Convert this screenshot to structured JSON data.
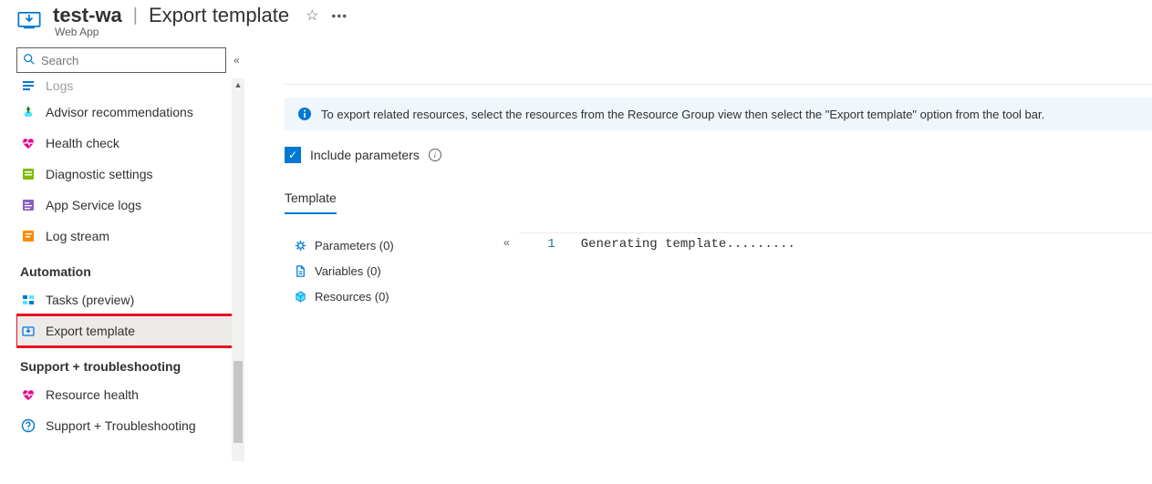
{
  "header": {
    "resource_name": "test-wa",
    "page_title": "Export template",
    "resource_type": "Web App"
  },
  "search": {
    "placeholder": "Search"
  },
  "sidebar": {
    "topcut_label": "Logs",
    "items": [
      {
        "icon": "advisor",
        "label": "Advisor recommendations"
      },
      {
        "icon": "health",
        "label": "Health check"
      },
      {
        "icon": "diag",
        "label": "Diagnostic settings"
      },
      {
        "icon": "applogs",
        "label": "App Service logs"
      },
      {
        "icon": "stream",
        "label": "Log stream"
      }
    ],
    "section_automation": "Automation",
    "automation_items": [
      {
        "icon": "tasks",
        "label": "Tasks (preview)"
      },
      {
        "icon": "export",
        "label": "Export template",
        "selected": true
      }
    ],
    "section_support": "Support + troubleshooting",
    "support_items": [
      {
        "icon": "reshealth",
        "label": "Resource health"
      },
      {
        "icon": "support",
        "label": "Support + Troubleshooting"
      }
    ]
  },
  "main": {
    "info_text": "To export related resources, select the resources from the Resource Group view then select the \"Export template\" option from the tool bar.",
    "include_params_label": "Include parameters",
    "tab_template": "Template",
    "tree": {
      "parameters": "Parameters (0)",
      "variables": "Variables (0)",
      "resources": "Resources (0)"
    },
    "editor": {
      "line1_num": "1",
      "line1_text": "Generating template........."
    }
  }
}
